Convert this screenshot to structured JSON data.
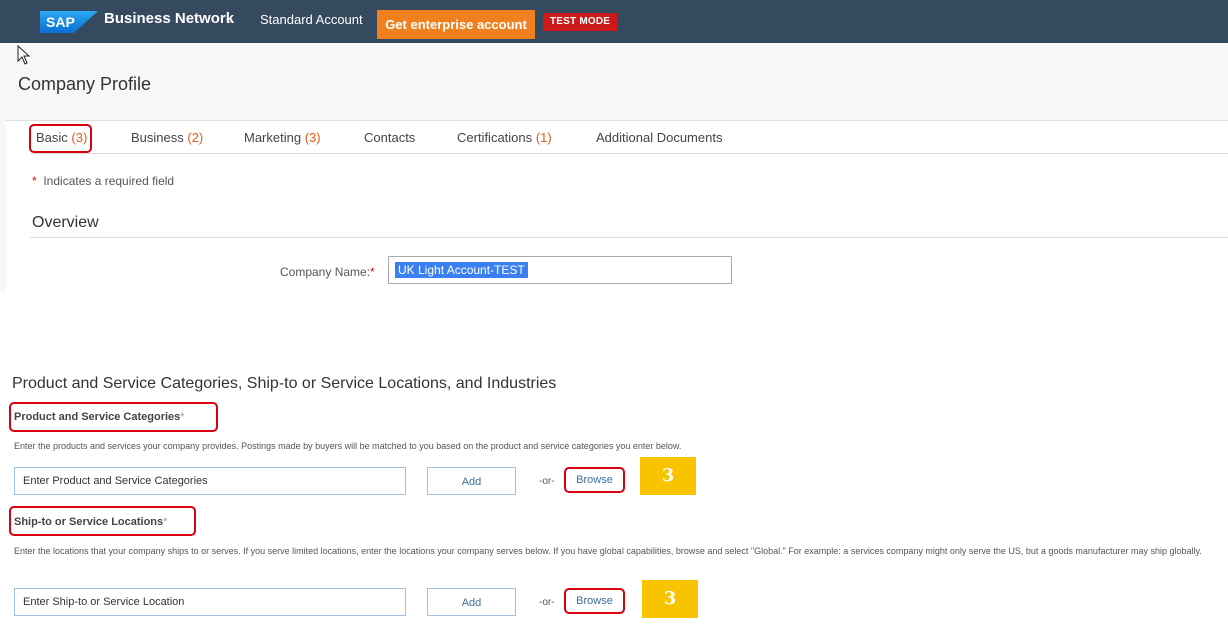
{
  "header": {
    "logo_text": "SAP",
    "brand": "Business Network",
    "brand_caret": "⌄",
    "account_type": "Standard Account",
    "enterprise_button": "Get enterprise account",
    "test_badge": "TEST MODE",
    "bg_color": "#354a5f",
    "accent_color": "#f0801e"
  },
  "page": {
    "title": "Company Profile"
  },
  "tabs": [
    {
      "label": "Basic",
      "count": "(3)",
      "active": true
    },
    {
      "label": "Business",
      "count": "(2)"
    },
    {
      "label": "Marketing",
      "count": "(3)"
    },
    {
      "label": "Contacts",
      "count": ""
    },
    {
      "label": "Certifications",
      "count": "(1)"
    },
    {
      "label": "Additional Documents",
      "count": ""
    }
  ],
  "form": {
    "required_star": "*",
    "required_note": "Indicates a required field",
    "overview_title": "Overview",
    "company_name_label": "Company Name:",
    "company_name_value": "UK Light Account-TEST"
  },
  "categories_section": {
    "title": "Product and Service Categories, Ship-to or Service Locations, and Industries",
    "product": {
      "heading": "Product and Service Categories",
      "description": "Enter the products and services your company provides. Postings made by buyers will be matched to you based on the product and service categories you enter below.",
      "placeholder": "Enter Product and Service Categories",
      "add_label": "Add",
      "or_label": "-or-",
      "browse_label": "Browse",
      "step": "3"
    },
    "shipping": {
      "heading": "Ship-to or Service Locations",
      "description": "Enter the locations that your company ships to or serves. If you serve limited locations, enter the locations your company serves below. If you have global capabilities, browse and select \"Global.\" For example: a services company might only serve the US, but a goods manufacturer may ship globally.",
      "placeholder": "Enter Ship-to or Service Location",
      "add_label": "Add",
      "or_label": "-or-",
      "browse_label": "Browse",
      "step": "3"
    }
  },
  "highlight_color": "#d9000f",
  "step_badge_color": "#f8c400"
}
